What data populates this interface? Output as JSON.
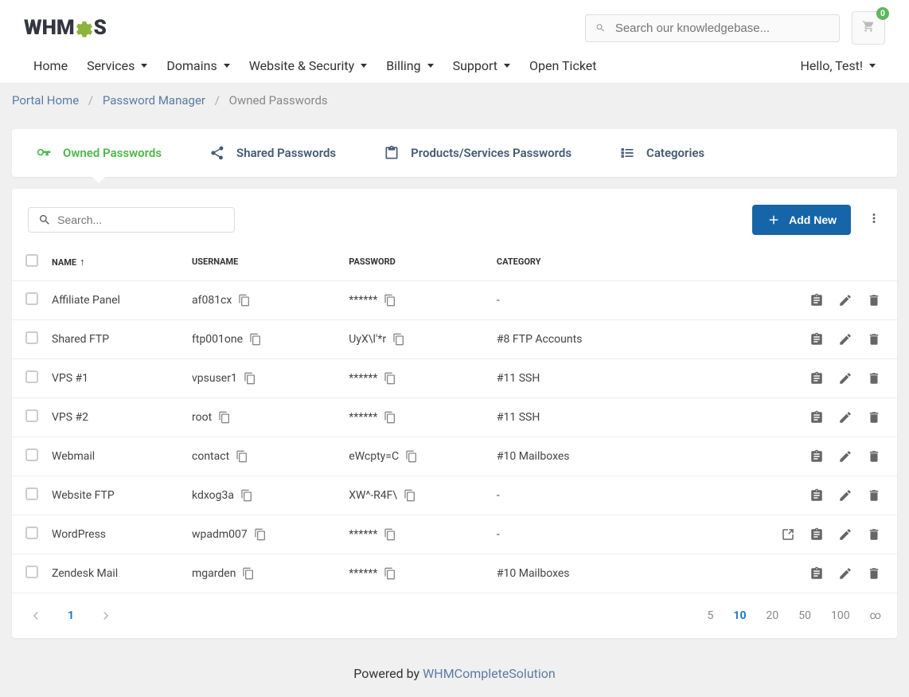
{
  "logo": {
    "prefix": "WHM",
    "suffix": "S"
  },
  "search": {
    "placeholder": "Search our knowledgebase..."
  },
  "cart": {
    "count": "0"
  },
  "nav": {
    "items": [
      "Home",
      "Services",
      "Domains",
      "Website & Security",
      "Billing",
      "Support",
      "Open Ticket"
    ],
    "has_caret": [
      false,
      true,
      true,
      true,
      true,
      true,
      false
    ],
    "user": "Hello, Test!"
  },
  "breadcrumb": {
    "home": "Portal Home",
    "parent": "Password Manager",
    "current": "Owned Passwords"
  },
  "tabs": [
    "Owned Passwords",
    "Shared Passwords",
    "Products/Services Passwords",
    "Categories"
  ],
  "toolbar": {
    "search_placeholder": "Search...",
    "add_label": "Add New"
  },
  "columns": {
    "name": "NAME",
    "username": "USERNAME",
    "password": "PASSWORD",
    "category": "CATEGORY"
  },
  "rows": [
    {
      "name": "Affiliate Panel",
      "username": "af081cx",
      "password": "******",
      "category": "-",
      "has_open": false
    },
    {
      "name": "Shared FTP",
      "username": "ftp001one",
      "password": "UyX\\l&#039;*r",
      "category": "#8 FTP Accounts",
      "has_open": false
    },
    {
      "name": "VPS #1",
      "username": "vpsuser1",
      "password": "******",
      "category": "#11 SSH",
      "has_open": false
    },
    {
      "name": "VPS #2",
      "username": "root",
      "password": "******",
      "category": "#11 SSH",
      "has_open": false
    },
    {
      "name": "Webmail",
      "username": "contact",
      "password": "eWcpty=C",
      "category": "#10 Mailboxes",
      "has_open": false
    },
    {
      "name": "Website FTP",
      "username": "kdxog3a",
      "password": "XW^-R4F\\",
      "category": "-",
      "has_open": false
    },
    {
      "name": "WordPress",
      "username": "wpadm007",
      "password": "******",
      "category": "-",
      "has_open": true
    },
    {
      "name": "Zendesk Mail",
      "username": "mgarden",
      "password": "******",
      "category": "#10 Mailboxes",
      "has_open": false
    }
  ],
  "pagination": {
    "current": "1",
    "sizes": [
      "5",
      "10",
      "20",
      "50",
      "100",
      "∞"
    ],
    "active_size": "10"
  },
  "footer": {
    "text": "Powered by ",
    "link": "WHMCompleteSolution"
  }
}
